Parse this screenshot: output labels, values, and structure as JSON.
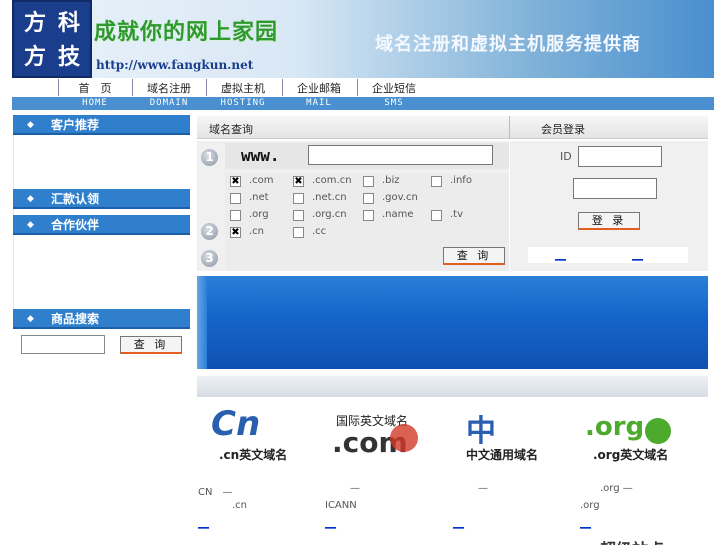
{
  "header": {
    "logo_chars": [
      "方",
      "科",
      "方",
      "技"
    ],
    "slogan": "成就你的网上家园",
    "url": "http://www.fangkun.net",
    "tagline": "域名注册和虚拟主机服务提供商"
  },
  "nav": {
    "items": [
      {
        "cn": "首　页",
        "en": "HOME"
      },
      {
        "cn": "域名注册",
        "en": "DOMAIN"
      },
      {
        "cn": "虚拟主机",
        "en": "HOSTING"
      },
      {
        "cn": "企业邮箱",
        "en": "MAIL"
      },
      {
        "cn": "企业短信",
        "en": "SMS"
      }
    ]
  },
  "sidebar": {
    "recommend": "客户推荐",
    "remit": "汇款认领",
    "partners": "合作伙伴",
    "product_search": "商品搜索",
    "search_button": "查 询"
  },
  "domain_query": {
    "title": "域名查询",
    "www_label": "www.",
    "step_numbers": [
      "1",
      "2",
      "3"
    ],
    "tlds": [
      {
        "label": ".com",
        "checked": true
      },
      {
        "label": ".com.cn",
        "checked": true
      },
      {
        "label": ".biz",
        "checked": false
      },
      {
        "label": ".info",
        "checked": false
      },
      {
        "label": ".net",
        "checked": false
      },
      {
        "label": ".net.cn",
        "checked": false
      },
      {
        "label": ".gov.cn",
        "checked": false
      },
      {
        "label": ".org",
        "checked": false
      },
      {
        "label": ".org.cn",
        "checked": false
      },
      {
        "label": ".name",
        "checked": false
      },
      {
        "label": ".tv",
        "checked": false
      },
      {
        "label": ".cn",
        "checked": true
      },
      {
        "label": ".cc",
        "checked": false
      }
    ],
    "check_mark": "✖",
    "query_button": "查 询"
  },
  "login": {
    "title": "会员登录",
    "id_label": "ID",
    "login_button": "登 录",
    "links": [
      "__",
      "__"
    ]
  },
  "domain_types": [
    {
      "logo": "Cn",
      "caption": ".cn英文域名",
      "meta1": "CN　—",
      "meta2": ".cn",
      "link": "__"
    },
    {
      "logo_top": "国际英文域名",
      "logo": ".com",
      "caption": "",
      "meta1": "—",
      "meta2": "ICANN",
      "link": "__"
    },
    {
      "logo": "中",
      "caption": "中文通用域名",
      "meta1": "—",
      "meta2": "",
      "link": "__"
    },
    {
      "logo": ".org",
      "caption": ".org英文域名",
      "meta1": ".org —",
      "meta2": ".org",
      "link": "__"
    }
  ],
  "bottom_text": "超级站点",
  "colors": {
    "nav_blue": "#4a8fcf",
    "side_blue": "#2f7fcc",
    "cn_blue": "#2a5fb0",
    "com_red": "#d23a2a",
    "org_green": "#4caa2c",
    "slogan_green": "#2e9a2e"
  }
}
